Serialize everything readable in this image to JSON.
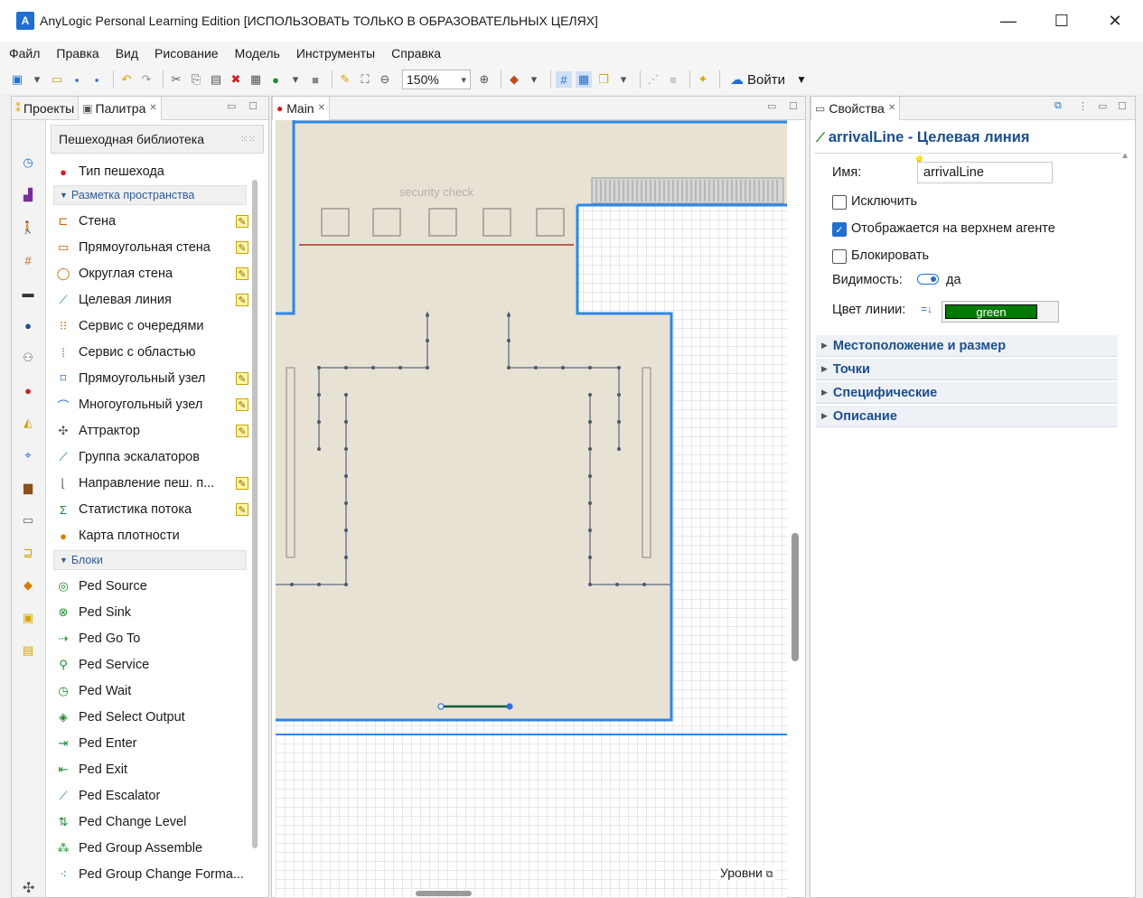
{
  "window": {
    "title": "AnyLogic Personal Learning Edition [ИСПОЛЬЗОВАТЬ ТОЛЬКО В ОБРАЗОВАТЕЛЬНЫХ ЦЕЛЯХ]",
    "min": "—",
    "max": "☐",
    "close": "✕"
  },
  "menu": [
    "Файл",
    "Правка",
    "Вид",
    "Рисование",
    "Модель",
    "Инструменты",
    "Справка"
  ],
  "toolbar": {
    "zoom": "150%",
    "login": "Войти"
  },
  "left_panel": {
    "tabs": {
      "projects": "Проекты",
      "palette": "Палитра"
    },
    "palette_title": "Пешеходная библиотека",
    "items_top": [
      {
        "label": "Тип пешехода",
        "icon": "person-type-icon"
      }
    ],
    "section_markup": "Разметка пространства",
    "markup_items": [
      {
        "label": "Стена"
      },
      {
        "label": "Прямоугольная стена"
      },
      {
        "label": "Округлая стена"
      },
      {
        "label": "Целевая линия"
      },
      {
        "label": "Сервис с очередями"
      },
      {
        "label": "Сервис с областью"
      },
      {
        "label": "Прямоугольный узел"
      },
      {
        "label": "Многоугольный узел"
      },
      {
        "label": "Аттрактор"
      },
      {
        "label": "Группа эскалаторов"
      },
      {
        "label": "Направление пеш. п..."
      },
      {
        "label": "Статистика потока"
      },
      {
        "label": "Карта плотности"
      }
    ],
    "section_blocks": "Блоки",
    "block_items": [
      {
        "label": "Ped Source"
      },
      {
        "label": "Ped Sink"
      },
      {
        "label": "Ped Go To"
      },
      {
        "label": "Ped Service"
      },
      {
        "label": "Ped Wait"
      },
      {
        "label": "Ped Select Output"
      },
      {
        "label": "Ped Enter"
      },
      {
        "label": "Ped Exit"
      },
      {
        "label": "Ped Escalator"
      },
      {
        "label": "Ped Change Level"
      },
      {
        "label": "Ped Group Assemble"
      },
      {
        "label": "Ped Group Change Forma..."
      }
    ]
  },
  "main_panel": {
    "tab": "Main",
    "canvas_label": "security check",
    "levels": "Уровни"
  },
  "properties": {
    "tab": "Свойства",
    "title": "arrivalLine - Целевая линия",
    "name_label": "Имя:",
    "name_value": "arrivalLine",
    "exclude_label": "Исключить",
    "exclude_checked": false,
    "upper_agent_label": "Отображается на верхнем агенте",
    "upper_agent_checked": true,
    "lock_label": "Блокировать",
    "lock_checked": false,
    "visibility_label": "Видимость:",
    "visibility_value": "да",
    "line_color_label": "Цвет линии:",
    "line_color_value": "green",
    "line_color_hex": "#007a00",
    "sections": [
      "Местоположение и размер",
      "Точки",
      "Специфические",
      "Описание"
    ]
  }
}
